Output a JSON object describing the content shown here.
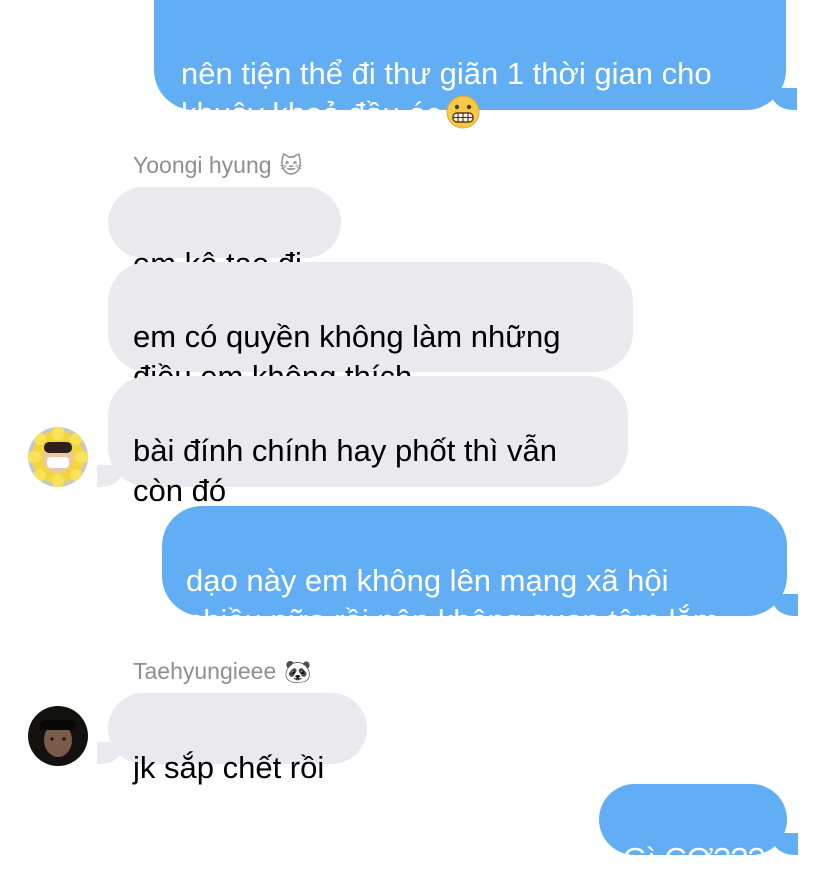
{
  "conversation": {
    "messages": [
      {
        "direction": "outgoing",
        "text": "nên tiện thể đi thư giãn 1 thời gian cho\nkhuây khoả đầu óc",
        "emoji": "grimacing-face"
      },
      {
        "direction": "incoming",
        "text": "em kệ tae đi"
      },
      {
        "direction": "incoming",
        "text": "em có quyền không làm những\nđiều em không thích"
      },
      {
        "direction": "incoming",
        "text": "bài đính chính hay phốt thì vẫn\ncòn đó"
      },
      {
        "direction": "outgoing",
        "text": "dạo này em không lên mạng xã hội\nnhiều nữa rồi nên không quan tâm lắm"
      },
      {
        "direction": "incoming",
        "text": "jk sắp chết rồi"
      },
      {
        "direction": "outgoing",
        "text": "Gì CƠ???"
      }
    ],
    "senders": [
      {
        "name": "Yoongi hyung",
        "emoji": "🐱"
      },
      {
        "name": "Taehyungieee",
        "emoji": "🐼"
      }
    ]
  },
  "colors": {
    "outgoing_bubble": "#62aef5",
    "incoming_bubble": "#e9e9ee",
    "sender_label": "#8e8e93"
  }
}
